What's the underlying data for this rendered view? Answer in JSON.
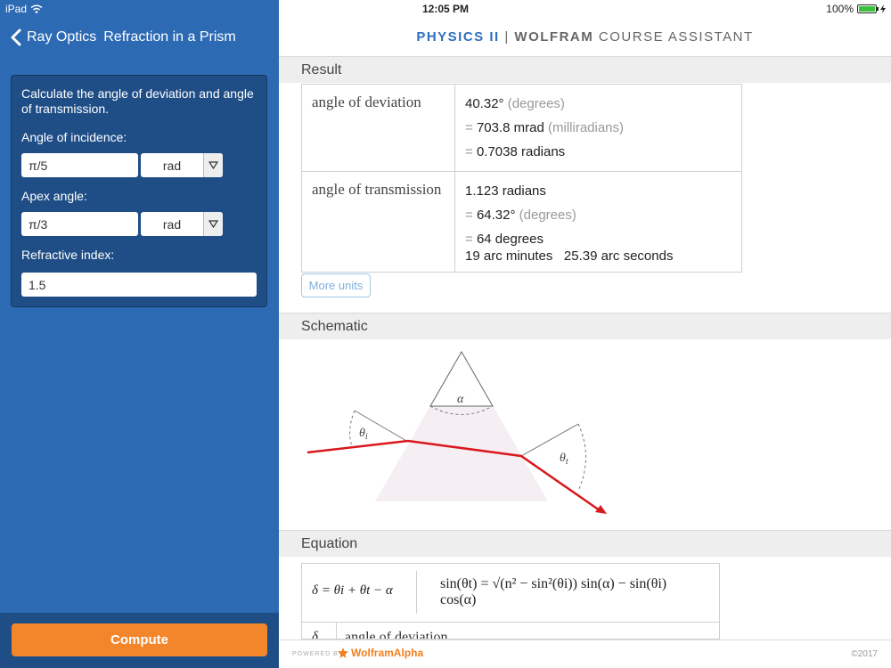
{
  "status_bar": {
    "device": "iPad",
    "time": "12:05 PM",
    "battery": "100%"
  },
  "nav": {
    "back_label": "Ray Optics",
    "title": "Refraction in a Prism"
  },
  "header": {
    "brand_part1": "PHYSICS II",
    "brand_separator": "|",
    "brand_part2": "WOLFRAM",
    "brand_part3": "COURSE ASSISTANT"
  },
  "form": {
    "description": "Calculate the angle of deviation and angle of transmission.",
    "incidence": {
      "label": "Angle of incidence:",
      "value": "π/5",
      "unit": "rad"
    },
    "apex": {
      "label": "Apex angle:",
      "value": "π/3",
      "unit": "rad"
    },
    "refractive": {
      "label": "Refractive index:",
      "value": "1.5"
    },
    "compute_label": "Compute"
  },
  "result": {
    "section_title": "Result",
    "rows": [
      {
        "name": "angle of deviation",
        "lines": [
          {
            "prefix": "",
            "value": "40.32°",
            "unit": "(degrees)"
          },
          {
            "prefix": "=",
            "value": "703.8 mrad",
            "unit": "(milliradians)"
          },
          {
            "prefix": "=",
            "value": "0.7038 radians",
            "unit": ""
          }
        ]
      },
      {
        "name": "angle of transmission",
        "lines": [
          {
            "prefix": "",
            "value": "1.123 radians",
            "unit": ""
          },
          {
            "prefix": "=",
            "value": "64.32°",
            "unit": "(degrees)"
          },
          {
            "prefix": "=",
            "value": "64 degrees",
            "unit": ""
          },
          {
            "prefix": "",
            "value": "19 arc minutes   25.39 arc seconds",
            "unit": ""
          }
        ]
      }
    ],
    "more_units_label": "More units"
  },
  "schematic": {
    "section_title": "Schematic",
    "labels": {
      "alpha": "α",
      "theta_i": "θ",
      "theta_i_sub": "i",
      "theta_t": "θ",
      "theta_t_sub": "t"
    }
  },
  "equation": {
    "section_title": "Equation",
    "lhs": "δ = θi + θt − α",
    "rhs_line1": "sin(θt) = √(n² − sin²(θi)) sin(α) − sin(θi)",
    "rhs_line2": "cos(α)",
    "symbol": "δ",
    "symbol_desc": "angle of deviation"
  },
  "footer": {
    "powered": "POWERED BY",
    "brand": "WolframAlpha",
    "copyright": "©2017"
  },
  "colors": {
    "sidebar": "#2c6ab3",
    "card": "#1f4e87",
    "compute": "#f3862a",
    "ray": "#d9171c",
    "brand_blue": "#2f6fbf"
  }
}
